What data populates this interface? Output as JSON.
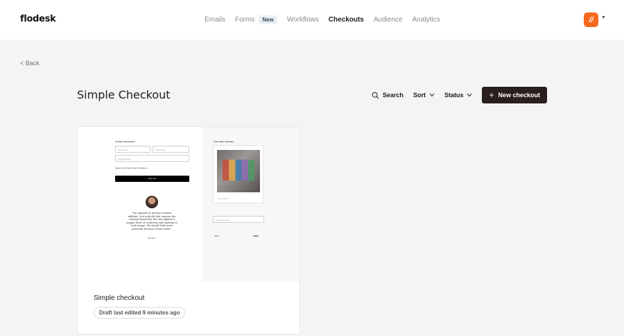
{
  "header": {
    "logo": "flodesk",
    "nav": [
      {
        "label": "Emails",
        "active": false
      },
      {
        "label": "Forms",
        "active": false,
        "badge": "New"
      },
      {
        "label": "Workflows",
        "active": false
      },
      {
        "label": "Checkouts",
        "active": true
      },
      {
        "label": "Audience",
        "active": false
      },
      {
        "label": "Analytics",
        "active": false
      }
    ],
    "avatar_color": "#f56a1f"
  },
  "back_label": "< Back",
  "page_title": "Simple Checkout",
  "toolbar": {
    "search_label": "Search",
    "sort_label": "Sort",
    "status_label": "Status",
    "new_label": "New checkout"
  },
  "card": {
    "title": "Simple checkout",
    "status": "Draft last edited 9 minutes ago",
    "preview": {
      "contact_heading": "Contact information",
      "first_name": "First name",
      "last_name": "Last name",
      "email": "Email address",
      "agree": "Agree to the Terms and Conditions",
      "pay_button": "Pay now",
      "quote": "\"I'm amazed at Aurora's artistic abilities. Not only did she capture the concept flawlessly, but she applied a unique level of creativity and emotion to each image. My brand feels more powerful because of her work.\"",
      "quote_author": "Ted Vint",
      "order_heading": "Your order summary",
      "order_link": "Item name",
      "discount": "Discount code",
      "total_label": "Total",
      "total_value": "FREE"
    }
  },
  "colors": {
    "primary_button": "#2a1f1f",
    "background": "#f4f4f4"
  }
}
